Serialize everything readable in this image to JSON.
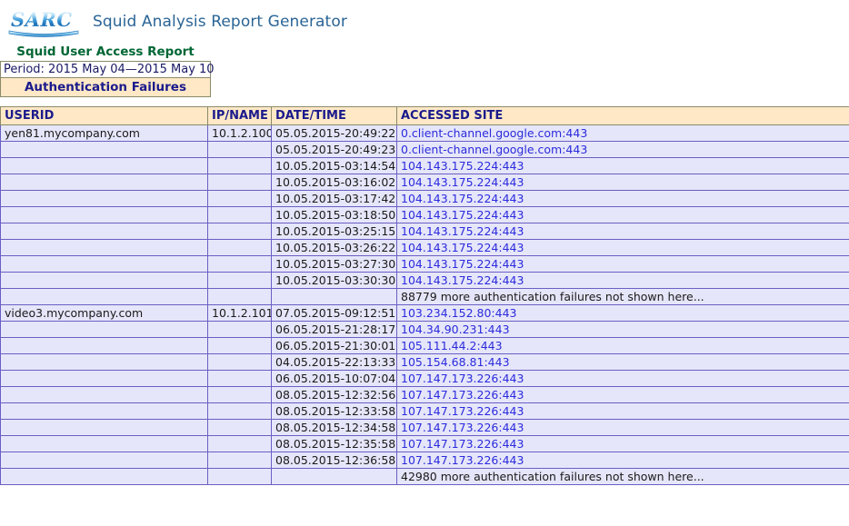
{
  "app": {
    "logo_text": "SARC",
    "title": "Squid Analysis Report Generator",
    "title_color": "#2a6496",
    "logo_color": "#1f7fd0"
  },
  "report": {
    "title": "Squid User Access Report",
    "title_color": "#006633",
    "period": "Period: 2015 May 04—2015 May 10",
    "section": "Authentication Failures",
    "header_bg": "#ffe8c6",
    "header_text_color": "#1a1a8c",
    "row_bg": "#e6e6fa",
    "row_border": "#6a5fc4",
    "link_color": "#2b2bdd"
  },
  "table": {
    "columns": [
      "USERID",
      "IP/NAME",
      "DATE/TIME",
      "ACCESSED SITE"
    ],
    "rows": [
      {
        "userid": "yen81.mycompany.com",
        "ip": "10.1.2.100",
        "datetime": "05.05.2015-20:49:22",
        "site": "0.client-channel.google.com:443",
        "is_link": true
      },
      {
        "userid": "",
        "ip": "",
        "datetime": "05.05.2015-20:49:23",
        "site": "0.client-channel.google.com:443",
        "is_link": true
      },
      {
        "userid": "",
        "ip": "",
        "datetime": "10.05.2015-03:14:54",
        "site": "104.143.175.224:443",
        "is_link": true
      },
      {
        "userid": "",
        "ip": "",
        "datetime": "10.05.2015-03:16:02",
        "site": "104.143.175.224:443",
        "is_link": true
      },
      {
        "userid": "",
        "ip": "",
        "datetime": "10.05.2015-03:17:42",
        "site": "104.143.175.224:443",
        "is_link": true
      },
      {
        "userid": "",
        "ip": "",
        "datetime": "10.05.2015-03:18:50",
        "site": "104.143.175.224:443",
        "is_link": true
      },
      {
        "userid": "",
        "ip": "",
        "datetime": "10.05.2015-03:25:15",
        "site": "104.143.175.224:443",
        "is_link": true
      },
      {
        "userid": "",
        "ip": "",
        "datetime": "10.05.2015-03:26:22",
        "site": "104.143.175.224:443",
        "is_link": true
      },
      {
        "userid": "",
        "ip": "",
        "datetime": "10.05.2015-03:27:30",
        "site": "104.143.175.224:443",
        "is_link": true
      },
      {
        "userid": "",
        "ip": "",
        "datetime": "10.05.2015-03:30:30",
        "site": "104.143.175.224:443",
        "is_link": true
      },
      {
        "userid": "",
        "ip": "",
        "datetime": "",
        "site": "88779 more authentication failures not shown here...",
        "is_link": false
      },
      {
        "userid": "video3.mycompany.com",
        "ip": "10.1.2.101",
        "datetime": "07.05.2015-09:12:51",
        "site": "103.234.152.80:443",
        "is_link": true
      },
      {
        "userid": "",
        "ip": "",
        "datetime": "06.05.2015-21:28:17",
        "site": "104.34.90.231:443",
        "is_link": true
      },
      {
        "userid": "",
        "ip": "",
        "datetime": "06.05.2015-21:30:01",
        "site": "105.111.44.2:443",
        "is_link": true
      },
      {
        "userid": "",
        "ip": "",
        "datetime": "04.05.2015-22:13:33",
        "site": "105.154.68.81:443",
        "is_link": true
      },
      {
        "userid": "",
        "ip": "",
        "datetime": "06.05.2015-10:07:04",
        "site": "107.147.173.226:443",
        "is_link": true
      },
      {
        "userid": "",
        "ip": "",
        "datetime": "08.05.2015-12:32:56",
        "site": "107.147.173.226:443",
        "is_link": true
      },
      {
        "userid": "",
        "ip": "",
        "datetime": "08.05.2015-12:33:58",
        "site": "107.147.173.226:443",
        "is_link": true
      },
      {
        "userid": "",
        "ip": "",
        "datetime": "08.05.2015-12:34:58",
        "site": "107.147.173.226:443",
        "is_link": true
      },
      {
        "userid": "",
        "ip": "",
        "datetime": "08.05.2015-12:35:58",
        "site": "107.147.173.226:443",
        "is_link": true
      },
      {
        "userid": "",
        "ip": "",
        "datetime": "08.05.2015-12:36:58",
        "site": "107.147.173.226:443",
        "is_link": true
      },
      {
        "userid": "",
        "ip": "",
        "datetime": "",
        "site": "42980 more authentication failures not shown here...",
        "is_link": false
      }
    ]
  }
}
